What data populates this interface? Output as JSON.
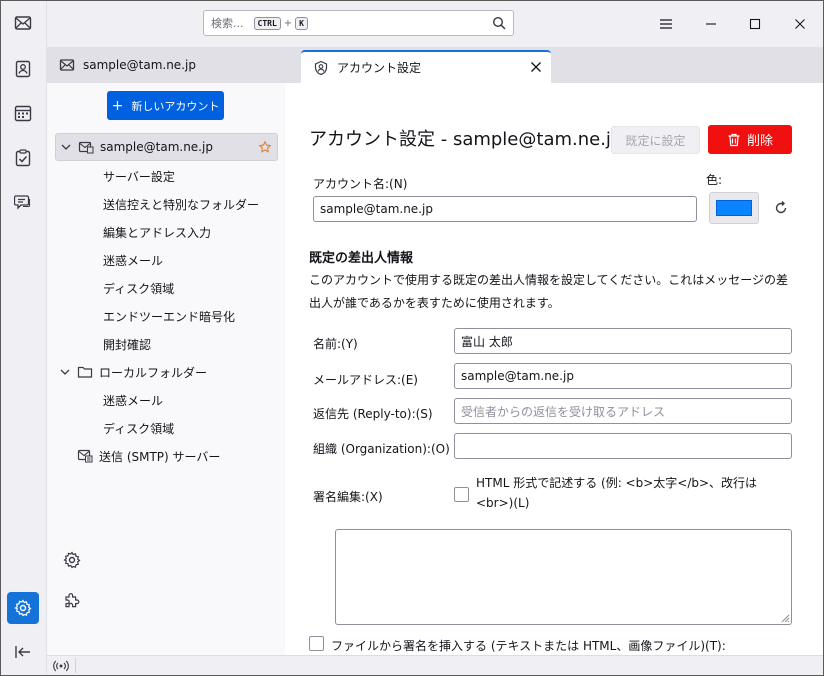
{
  "search": {
    "placeholder": "検索...",
    "kbd1": "CTRL",
    "plus": "+",
    "kbd2": "K"
  },
  "tabs": [
    {
      "label": "sample@tam.ne.jp"
    },
    {
      "label": "アカウント設定"
    }
  ],
  "account_pane": {
    "new_account_label": "新しいアカウント",
    "account_name": "sample@tam.ne.jp",
    "account_subitems": [
      "サーバー設定",
      "送信控えと特別なフォルダー",
      "編集とアドレス入力",
      "迷惑メール",
      "ディスク領域",
      "エンドツーエンド暗号化",
      "開封確認"
    ],
    "local_folders": "ローカルフォルダー",
    "local_subitems": [
      "迷惑メール",
      "ディスク領域"
    ],
    "smtp": "送信 (SMTP) サーバー"
  },
  "settings": {
    "title": "アカウント設定 - sample@tam.ne.jp",
    "set_default_label": "既定に設定",
    "delete_label": "削除",
    "account_name_label": "アカウント名:(N)",
    "account_name_value": "sample@tam.ne.jp",
    "color_label": "色:",
    "account_color": "#0a84ff",
    "identity_heading": "既定の差出人情報",
    "identity_desc": "このアカウントで使用する既定の差出人情報を設定してください。これはメッセージの差出人が誰であるかを表すために使用されます。",
    "name_label": "名前:(Y)",
    "name_value": "富山 太郎",
    "email_label": "メールアドレス:(E)",
    "email_value": "sample@tam.ne.jp",
    "replyto_label": "返信先 (Reply-to):(S)",
    "replyto_placeholder": "受信者からの返信を受け取るアドレス",
    "org_label": "組織 (Organization):(O)",
    "org_value": "",
    "sig_label": "署名編集:(X)",
    "html_checkbox_label": "HTML 形式で記述する (例: <b>太字</b>、改行は <br>)(L)",
    "file_sig_label": "ファイルから署名を挿入する (テキストまたは HTML、画像ファイル)(T):"
  }
}
